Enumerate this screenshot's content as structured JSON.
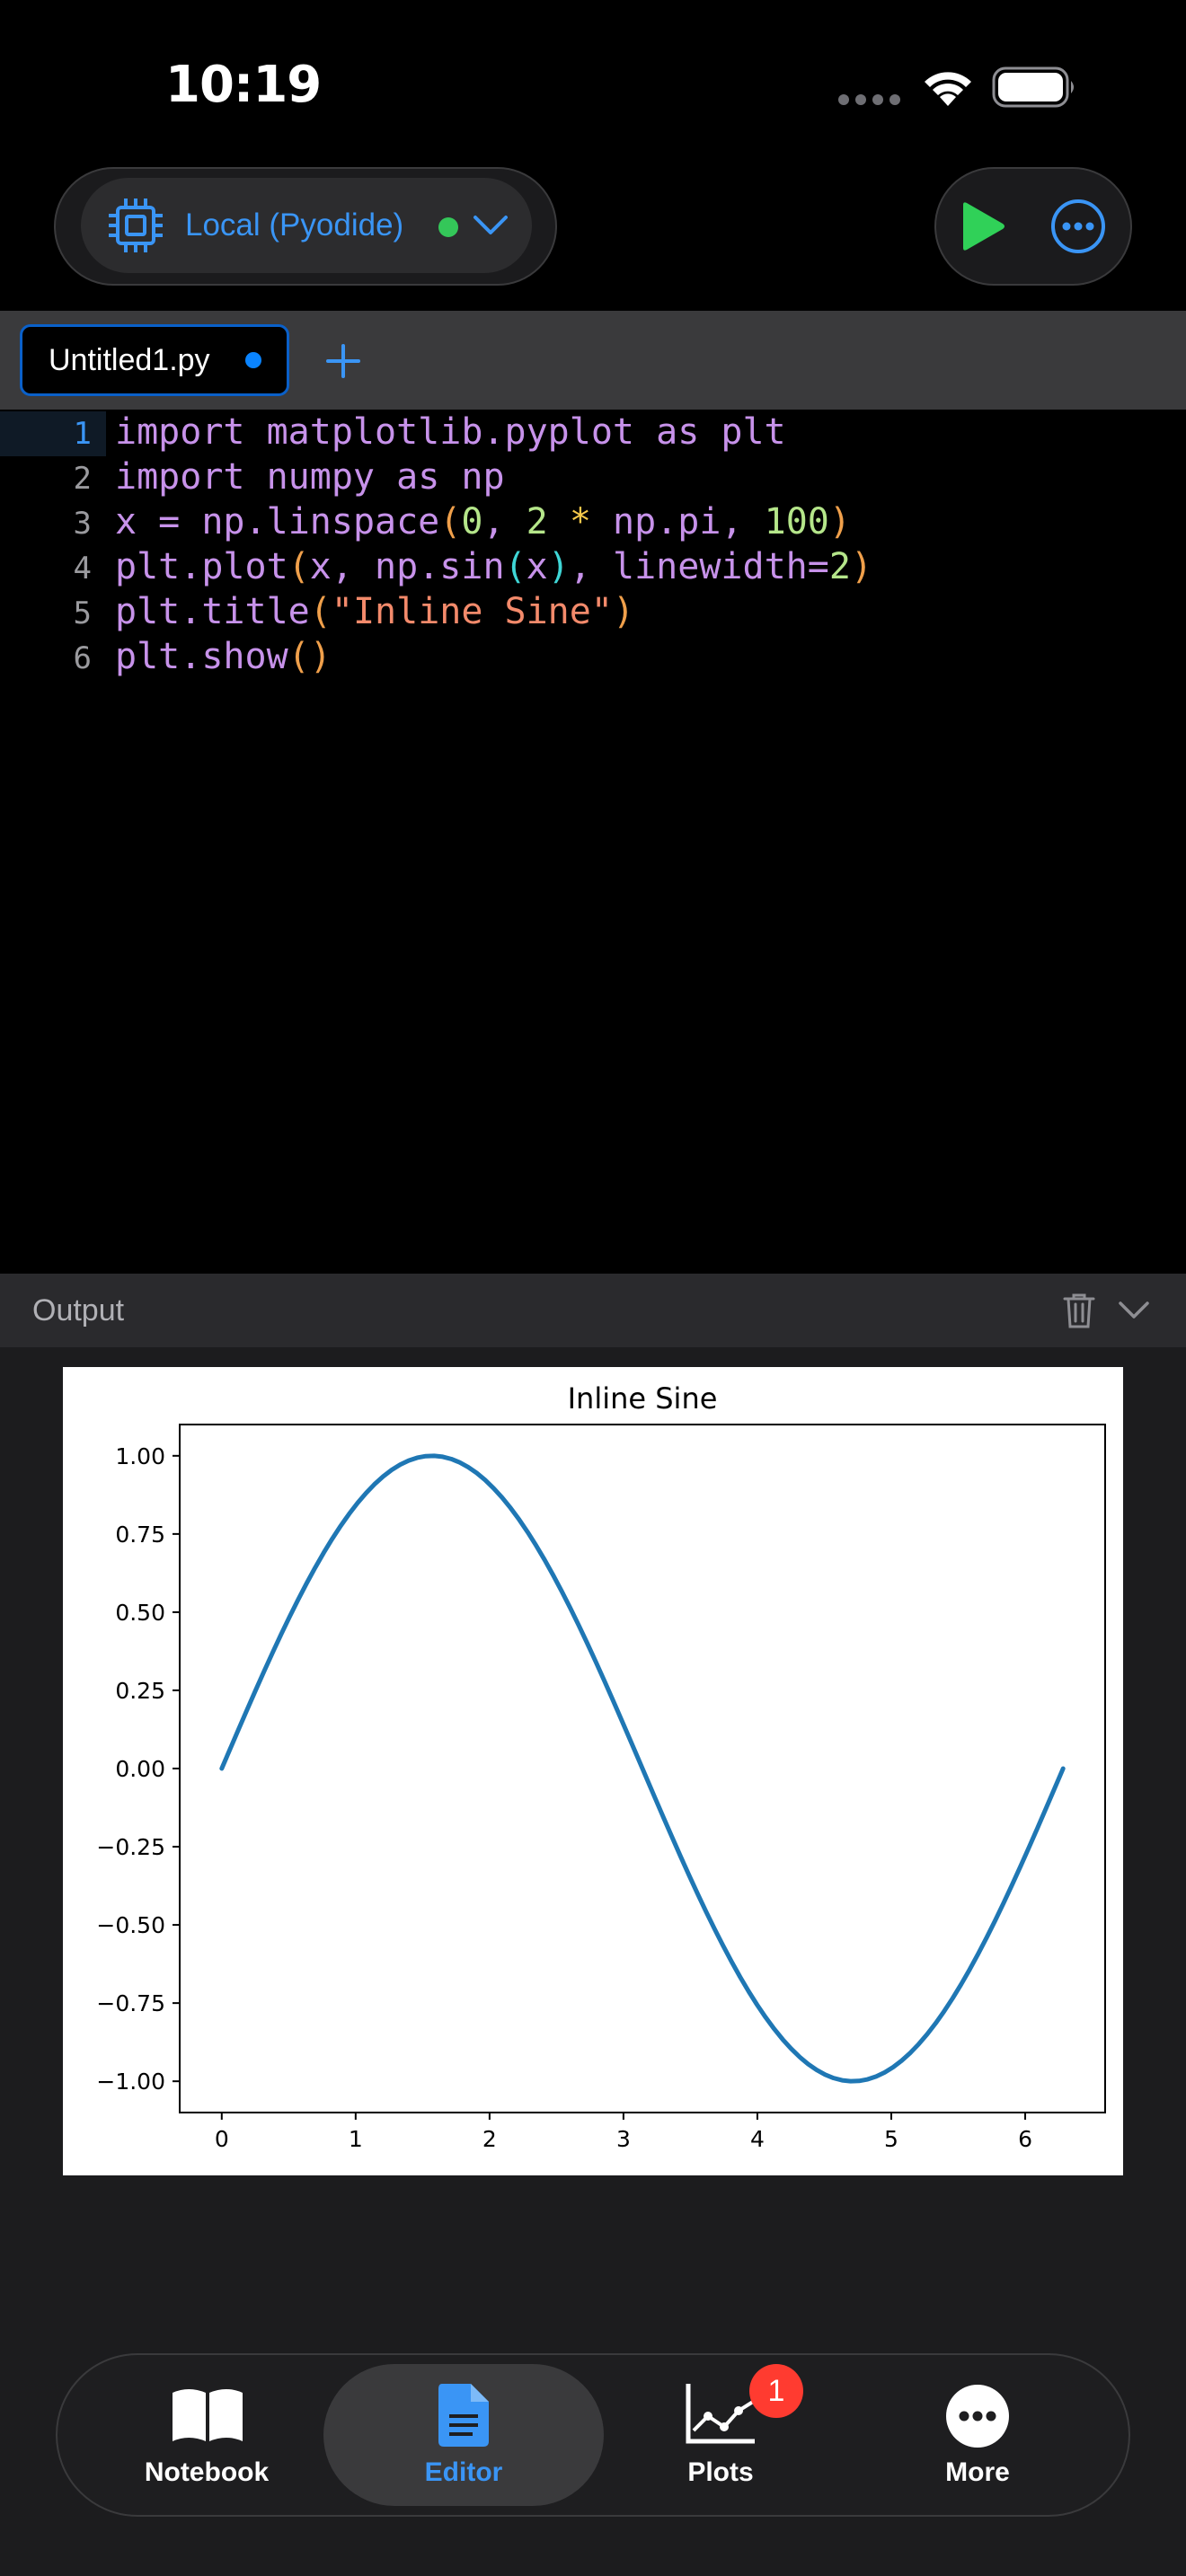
{
  "status_bar": {
    "time": "10:19"
  },
  "kernel": {
    "label": "Local (Pyodide)",
    "status_color": "#34c759"
  },
  "toolbar": {
    "run_icon": "play-icon",
    "more_icon": "ellipsis-circle-icon"
  },
  "tabs": [
    {
      "label": "Untitled1.py",
      "modified": true
    }
  ],
  "editor": {
    "line_numbers": [
      "1",
      "2",
      "3",
      "4",
      "5",
      "6"
    ],
    "lines": [
      "import matplotlib.pyplot as plt",
      "import numpy as np",
      "x = np.linspace(0, 2 * np.pi, 100)",
      "plt.plot(x, np.sin(x), linewidth=2)",
      "plt.title(\"Inline Sine\")",
      "plt.show()"
    ]
  },
  "output": {
    "label": "Output"
  },
  "chart_data": {
    "type": "line",
    "title": "Inline Sine",
    "xlabel": "",
    "ylabel": "",
    "xlim": [
      -0.314,
      6.597
    ],
    "ylim": [
      -1.1,
      1.1
    ],
    "x_ticks": [
      "0",
      "1",
      "2",
      "3",
      "4",
      "5",
      "6"
    ],
    "y_ticks": [
      "1.00",
      "0.75",
      "0.50",
      "0.25",
      "0.00",
      "−0.25",
      "−0.50",
      "−0.75",
      "−1.00"
    ],
    "series": [
      {
        "color": "#1f77b4",
        "function": "sin",
        "x_start": 0,
        "x_end": 6.283,
        "num_points": 100
      }
    ],
    "grid": false,
    "legend": "none"
  },
  "bottom_nav": {
    "items": [
      {
        "label": "Notebook",
        "icon": "book-icon",
        "active": false
      },
      {
        "label": "Editor",
        "icon": "document-icon",
        "active": true
      },
      {
        "label": "Plots",
        "icon": "chart-icon",
        "active": false,
        "badge": "1"
      },
      {
        "label": "More",
        "icon": "ellipsis-icon",
        "active": false
      }
    ],
    "active_color": "#3a95f5"
  }
}
